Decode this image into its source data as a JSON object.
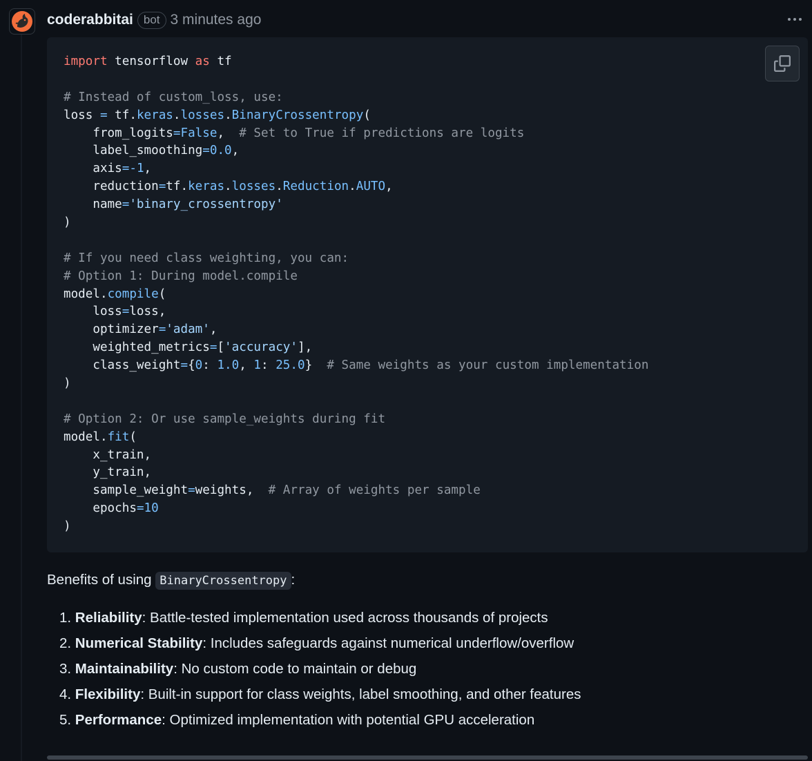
{
  "comment": {
    "author": "coderabbitai",
    "badge": "bot",
    "time": "3 minutes ago"
  },
  "code_lines": [
    [
      {
        "t": "import",
        "c": "kw"
      },
      {
        "t": " tensorflow ",
        "c": "nm"
      },
      {
        "t": "as",
        "c": "kw"
      },
      {
        "t": " tf",
        "c": "nm"
      }
    ],
    [],
    [
      {
        "t": "# Instead of custom_loss, use:",
        "c": "cm"
      }
    ],
    [
      {
        "t": "loss ",
        "c": "nm"
      },
      {
        "t": "=",
        "c": "op"
      },
      {
        "t": " tf.",
        "c": "nm"
      },
      {
        "t": "keras",
        "c": "at"
      },
      {
        "t": ".",
        "c": "nm"
      },
      {
        "t": "losses",
        "c": "at"
      },
      {
        "t": ".",
        "c": "nm"
      },
      {
        "t": "BinaryCrossentropy",
        "c": "at"
      },
      {
        "t": "(",
        "c": "nm"
      }
    ],
    [
      {
        "t": "    from_logits",
        "c": "nm"
      },
      {
        "t": "=",
        "c": "op"
      },
      {
        "t": "False",
        "c": "num"
      },
      {
        "t": ",  ",
        "c": "nm"
      },
      {
        "t": "# Set to True if predictions are logits",
        "c": "cm"
      }
    ],
    [
      {
        "t": "    label_smoothing",
        "c": "nm"
      },
      {
        "t": "=",
        "c": "op"
      },
      {
        "t": "0.0",
        "c": "num"
      },
      {
        "t": ",",
        "c": "nm"
      }
    ],
    [
      {
        "t": "    axis",
        "c": "nm"
      },
      {
        "t": "=-",
        "c": "op"
      },
      {
        "t": "1",
        "c": "num"
      },
      {
        "t": ",",
        "c": "nm"
      }
    ],
    [
      {
        "t": "    reduction",
        "c": "nm"
      },
      {
        "t": "=",
        "c": "op"
      },
      {
        "t": "tf.",
        "c": "nm"
      },
      {
        "t": "keras",
        "c": "at"
      },
      {
        "t": ".",
        "c": "nm"
      },
      {
        "t": "losses",
        "c": "at"
      },
      {
        "t": ".",
        "c": "nm"
      },
      {
        "t": "Reduction",
        "c": "at"
      },
      {
        "t": ".",
        "c": "nm"
      },
      {
        "t": "AUTO",
        "c": "at"
      },
      {
        "t": ",",
        "c": "nm"
      }
    ],
    [
      {
        "t": "    name",
        "c": "nm"
      },
      {
        "t": "=",
        "c": "op"
      },
      {
        "t": "'binary_crossentropy'",
        "c": "st"
      }
    ],
    [
      {
        "t": ")",
        "c": "nm"
      }
    ],
    [],
    [
      {
        "t": "# If you need class weighting, you can:",
        "c": "cm"
      }
    ],
    [
      {
        "t": "# Option 1: During model.compile",
        "c": "cm"
      }
    ],
    [
      {
        "t": "model.",
        "c": "nm"
      },
      {
        "t": "compile",
        "c": "at"
      },
      {
        "t": "(",
        "c": "nm"
      }
    ],
    [
      {
        "t": "    loss",
        "c": "nm"
      },
      {
        "t": "=",
        "c": "op"
      },
      {
        "t": "loss,",
        "c": "nm"
      }
    ],
    [
      {
        "t": "    optimizer",
        "c": "nm"
      },
      {
        "t": "=",
        "c": "op"
      },
      {
        "t": "'adam'",
        "c": "st"
      },
      {
        "t": ",",
        "c": "nm"
      }
    ],
    [
      {
        "t": "    weighted_metrics",
        "c": "nm"
      },
      {
        "t": "=",
        "c": "op"
      },
      {
        "t": "[",
        "c": "nm"
      },
      {
        "t": "'accuracy'",
        "c": "st"
      },
      {
        "t": "],",
        "c": "nm"
      }
    ],
    [
      {
        "t": "    class_weight",
        "c": "nm"
      },
      {
        "t": "=",
        "c": "op"
      },
      {
        "t": "{",
        "c": "nm"
      },
      {
        "t": "0",
        "c": "num"
      },
      {
        "t": ": ",
        "c": "nm"
      },
      {
        "t": "1.0",
        "c": "num"
      },
      {
        "t": ", ",
        "c": "nm"
      },
      {
        "t": "1",
        "c": "num"
      },
      {
        "t": ": ",
        "c": "nm"
      },
      {
        "t": "25.0",
        "c": "num"
      },
      {
        "t": "}  ",
        "c": "nm"
      },
      {
        "t": "# Same weights as your custom implementation",
        "c": "cm"
      }
    ],
    [
      {
        "t": ")",
        "c": "nm"
      }
    ],
    [],
    [
      {
        "t": "# Option 2: Or use sample_weights during fit",
        "c": "cm"
      }
    ],
    [
      {
        "t": "model.",
        "c": "nm"
      },
      {
        "t": "fit",
        "c": "at"
      },
      {
        "t": "(",
        "c": "nm"
      }
    ],
    [
      {
        "t": "    x_train,",
        "c": "nm"
      }
    ],
    [
      {
        "t": "    y_train,",
        "c": "nm"
      }
    ],
    [
      {
        "t": "    sample_weight",
        "c": "nm"
      },
      {
        "t": "=",
        "c": "op"
      },
      {
        "t": "weights,  ",
        "c": "nm"
      },
      {
        "t": "# Array of weights per sample",
        "c": "cm"
      }
    ],
    [
      {
        "t": "    epochs",
        "c": "nm"
      },
      {
        "t": "=",
        "c": "op"
      },
      {
        "t": "10",
        "c": "num"
      }
    ],
    [
      {
        "t": ")",
        "c": "nm"
      }
    ]
  ],
  "benefits": {
    "intro_prefix": "Benefits of using ",
    "intro_code": "BinaryCrossentropy",
    "intro_suffix": ":",
    "items": [
      {
        "num": "1.",
        "title": "Reliability",
        "text": ": Battle-tested implementation used across thousands of projects"
      },
      {
        "num": "2.",
        "title": "Numerical Stability",
        "text": ": Includes safeguards against numerical underflow/overflow"
      },
      {
        "num": "3.",
        "title": "Maintainability",
        "text": ": No custom code to maintain or debug"
      },
      {
        "num": "4.",
        "title": "Flexibility",
        "text": ": Built-in support for class weights, label smoothing, and other features"
      },
      {
        "num": "5.",
        "title": "Performance",
        "text": ": Optimized implementation with potential GPU acceleration"
      }
    ]
  },
  "icons": {
    "avatar": "coderabbit-logo-icon",
    "copy": "copy-icon",
    "more": "kebab-menu-icon"
  },
  "colors": {
    "background": "#0d1117",
    "code_background": "#151b23",
    "keyword": "#ff7b72",
    "comment": "#9198a1",
    "constant": "#79c0ff",
    "string": "#a5d6ff",
    "avatar_orange": "#f36e3c"
  }
}
